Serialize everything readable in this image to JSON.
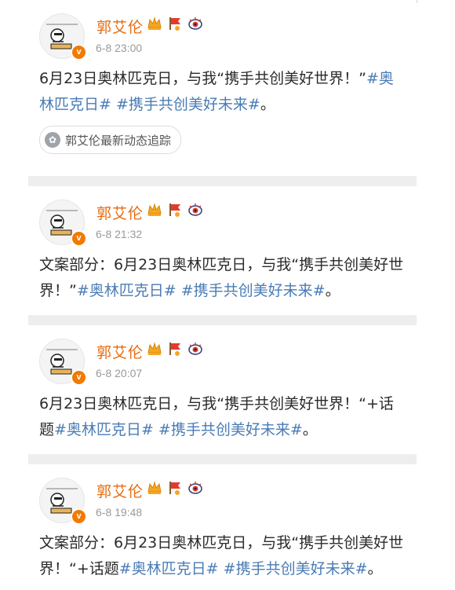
{
  "colors": {
    "name": "#e86b0e",
    "hashtag": "#4a7cb5",
    "verified": "#f27a00",
    "separator": "#eeeeee"
  },
  "icons": [
    "crown-icon",
    "red-flag-icon",
    "eye-icon",
    "verified-icon"
  ],
  "posts": [
    {
      "author": "郭艾伦",
      "time": "6-8 23:00",
      "pre": "6月23日奥林匹克日，与我“携手共创美好世界！”",
      "tag1": "#奥林匹克日#",
      "tag2": "#携手共创美好未来#",
      "post": "。",
      "follow_label": "郭艾伦最新动态追踪"
    },
    {
      "author": "郭艾伦",
      "time": "6-8 21:32",
      "pre": "文案部分：6月23日奥林匹克日，与我“携手共创美好世界！”",
      "tag1": "#奥林匹克日#",
      "tag2": "#携手共创美好未来#",
      "post": "。"
    },
    {
      "author": "郭艾伦",
      "time": "6-8 20:07",
      "pre": "6月23日奥林匹克日，与我“携手共创美好世界！“+话题",
      "tag1": "#奥林匹克日#",
      "tag2": "#携手共创美好未来#",
      "post": "。"
    },
    {
      "author": "郭艾伦",
      "time": "6-8 19:48",
      "pre": "文案部分：6月23日奥林匹克日，与我“携手共创美好世界！“+话题",
      "tag1": "#奥林匹克日#",
      "tag2": "#携手共创美好未来#",
      "post": "。"
    }
  ]
}
